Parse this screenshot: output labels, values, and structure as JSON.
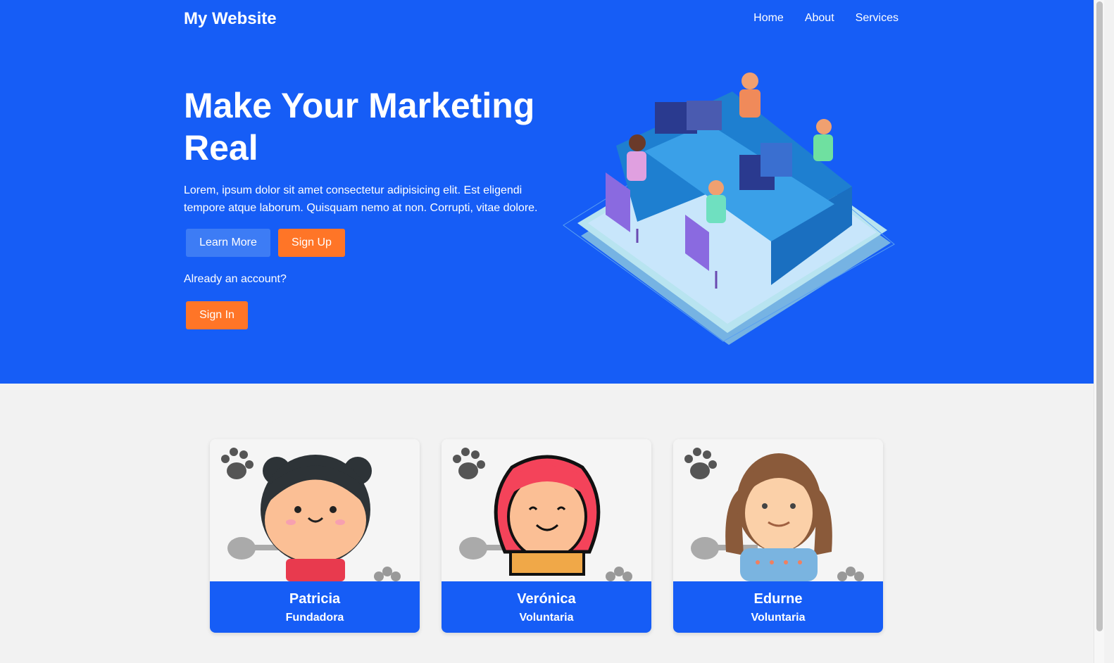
{
  "header": {
    "brand": "My Website",
    "nav": [
      "Home",
      "About",
      "Services"
    ]
  },
  "hero": {
    "title": "Make Your Marketing Real",
    "text": "Lorem, ipsum dolor sit amet consectetur adipisicing elit. Est eligendi tempore atque laborum. Quisquam nemo at non. Corrupti, vitae dolore.",
    "learn_more": "Learn More",
    "sign_up": "Sign Up",
    "already": "Already an account?",
    "sign_in": "Sign In"
  },
  "team": [
    {
      "name": "Patricia",
      "role": "Fundadora"
    },
    {
      "name": "Verónica",
      "role": "Voluntaria"
    },
    {
      "name": "Edurne",
      "role": "Voluntaria"
    }
  ],
  "colors": {
    "primary": "#165df6",
    "accent": "#ff7527",
    "secondary_button": "#3d7cf5",
    "background": "#f2f2f2"
  }
}
